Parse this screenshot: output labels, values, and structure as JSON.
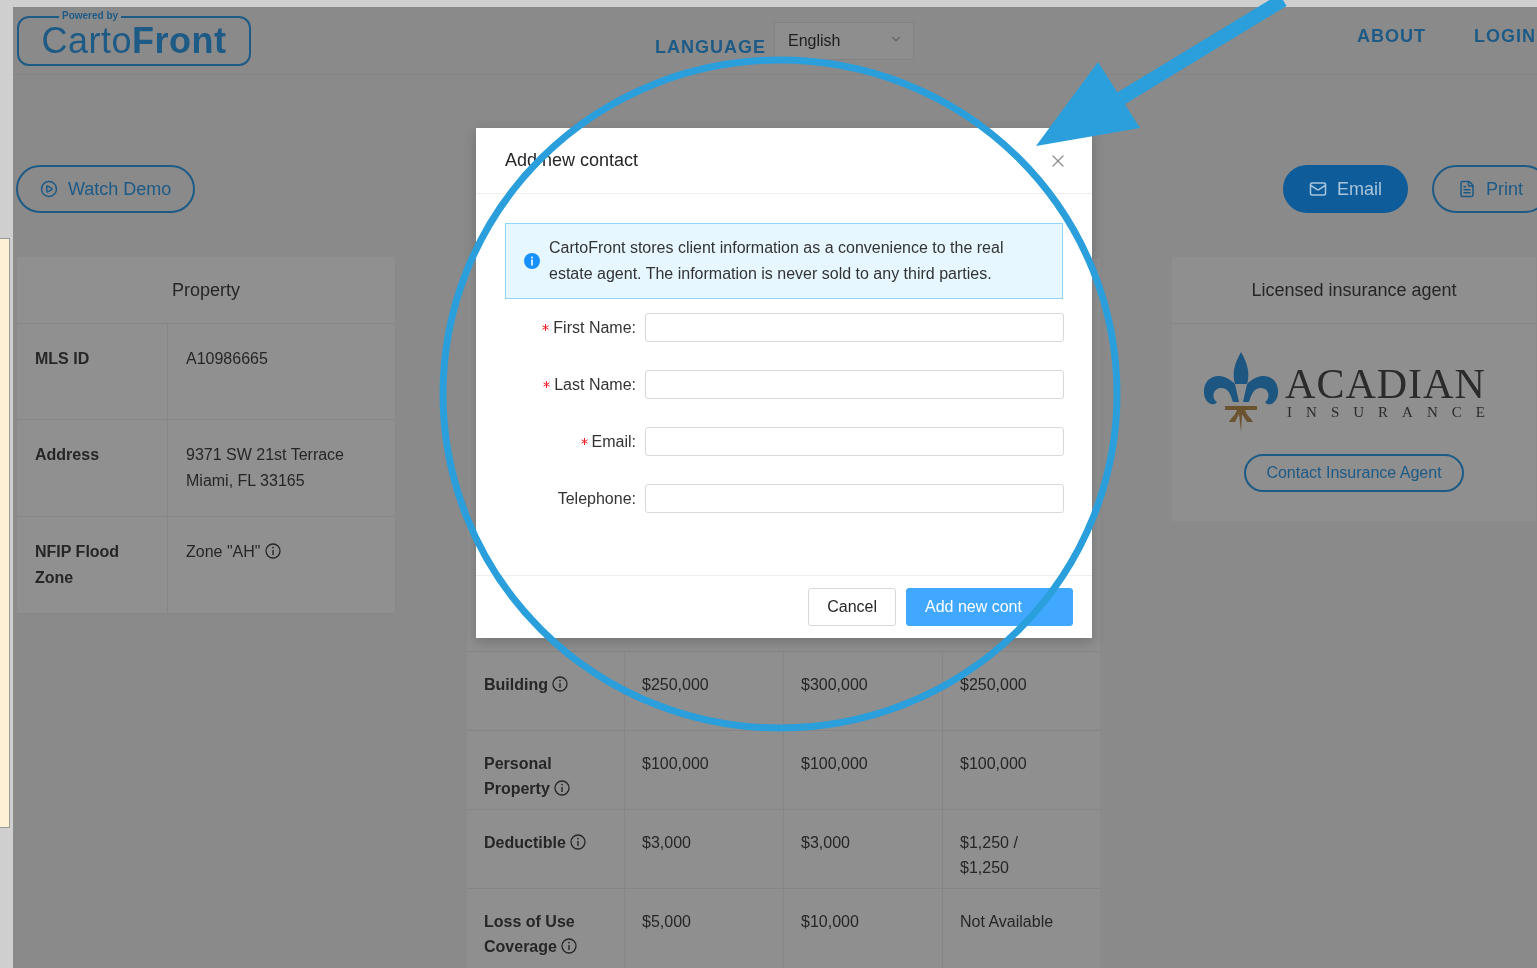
{
  "header": {
    "logo": {
      "tagline": "Powered by",
      "name": "Carto**Front**"
    },
    "language": {
      "label": "LANGUAGE",
      "value": "English"
    },
    "nav": [
      "ABOUT",
      "LOGIN"
    ]
  },
  "toolbar": {
    "demo_button": "Watch Demo",
    "actions": [
      {
        "kind": "email",
        "label": "Email",
        "primary": true
      },
      {
        "kind": "print",
        "label": "Print",
        "primary": false
      }
    ]
  },
  "property": {
    "title": "Property",
    "rows": [
      {
        "label": "MLS ID",
        "value": "A10986665",
        "info": false
      },
      {
        "label": "Address",
        "value": "9371 SW 21st Terrace\nMiami, FL 33165",
        "info": false
      },
      {
        "label": "NFIP Flood Zone",
        "value": "Zone \"AH\"",
        "info": true
      }
    ]
  },
  "coverage": {
    "rows": [
      {
        "label": "Building",
        "info": true,
        "values": [
          "$250,000",
          "$300,000",
          "$250,000"
        ]
      },
      {
        "label": "Personal Property",
        "info": true,
        "values": [
          "$100,000",
          "$100,000",
          "$100,000"
        ]
      },
      {
        "label": "Deductible",
        "info": true,
        "values": [
          "$3,000",
          "$3,000",
          "$1,250 /\n$1,250"
        ]
      },
      {
        "label": "Loss of Use Coverage",
        "info": true,
        "values": [
          "$5,000",
          "$10,000",
          "Not Available"
        ]
      }
    ]
  },
  "agent": {
    "title": "Licensed insurance agent",
    "logo": {
      "name": "ACADIAN",
      "sub": "INSURANCE"
    },
    "button": "Contact Insurance Agent"
  },
  "modal": {
    "title": "Add new contact",
    "notice": "CartoFront stores client information as a convenience to the real estate agent. The information is never sold to any third parties.",
    "fields": [
      {
        "label": "First Name:",
        "required": true
      },
      {
        "label": "Last Name:",
        "required": true
      },
      {
        "label": "Email:",
        "required": true
      },
      {
        "label": "Telephone:",
        "required": false
      }
    ],
    "cancel": "Cancel",
    "submit": "Add new cont"
  }
}
